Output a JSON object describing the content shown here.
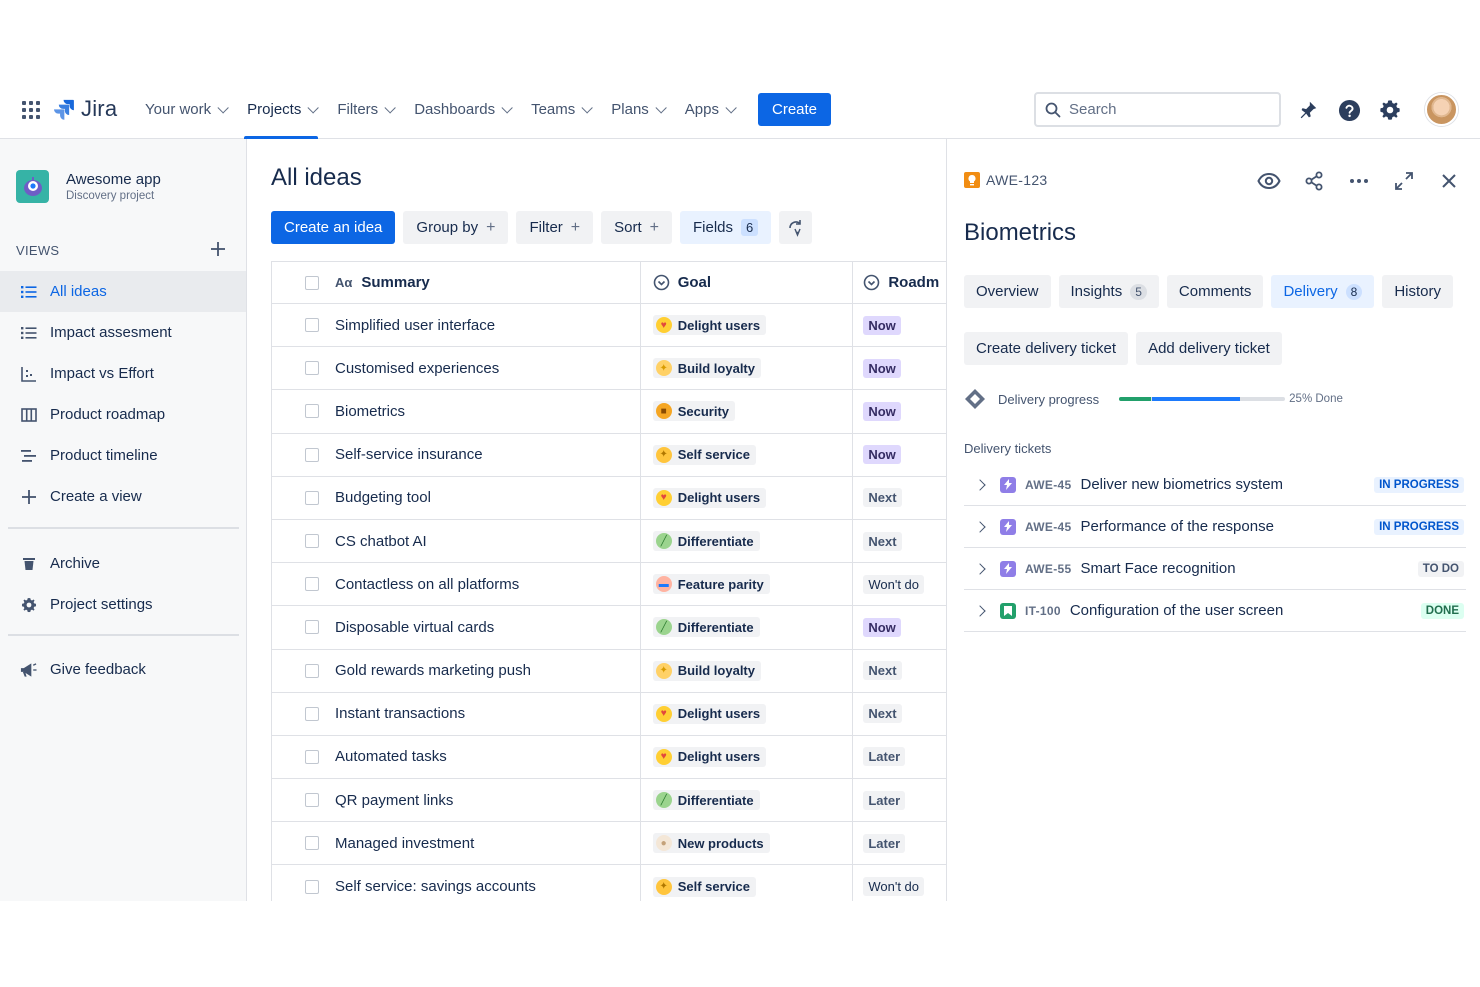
{
  "nav": {
    "logo": "Jira",
    "items": [
      {
        "label": "Your work",
        "active": false
      },
      {
        "label": "Projects",
        "active": true
      },
      {
        "label": "Filters",
        "active": false
      },
      {
        "label": "Dashboards",
        "active": false
      },
      {
        "label": "Teams",
        "active": false
      },
      {
        "label": "Plans",
        "active": false
      },
      {
        "label": "Apps",
        "active": false
      }
    ],
    "create_label": "Create",
    "search_placeholder": "Search"
  },
  "sidebar": {
    "project_name": "Awesome app",
    "project_type": "Discovery project",
    "views_header": "VIEWS",
    "views": [
      {
        "label": "All ideas",
        "icon": "list-icon",
        "active": true
      },
      {
        "label": "Impact assesment",
        "icon": "list-icon",
        "active": false
      },
      {
        "label": "Impact vs Effort",
        "icon": "scatter-icon",
        "active": false
      },
      {
        "label": "Product roadmap",
        "icon": "board-icon",
        "active": false
      },
      {
        "label": "Product timeline",
        "icon": "timeline-icon",
        "active": false
      },
      {
        "label": "Create a view",
        "icon": "plus-icon",
        "active": false
      }
    ],
    "archive_label": "Archive",
    "settings_label": "Project settings",
    "feedback_label": "Give feedback"
  },
  "main": {
    "title": "All ideas",
    "toolbar": {
      "create_idea": "Create an idea",
      "group_by": "Group by",
      "filter": "Filter",
      "sort": "Sort",
      "fields": "Fields",
      "fields_count": "6"
    },
    "columns": {
      "summary_icon": "Aα",
      "summary": "Summary",
      "goal": "Goal",
      "roadmap": "Roadm"
    },
    "rows": [
      {
        "summary": "Simplified user interface",
        "goal": "Delight users",
        "roadmap": "Now"
      },
      {
        "summary": "Customised experiences",
        "goal": "Build loyalty",
        "roadmap": "Now"
      },
      {
        "summary": "Biometrics",
        "goal": "Security",
        "roadmap": "Now"
      },
      {
        "summary": "Self-service insurance",
        "goal": "Self service",
        "roadmap": "Now"
      },
      {
        "summary": "Budgeting tool",
        "goal": "Delight users",
        "roadmap": "Next"
      },
      {
        "summary": "CS chatbot AI",
        "goal": "Differentiate",
        "roadmap": "Next"
      },
      {
        "summary": "Contactless on all platforms",
        "goal": "Feature parity",
        "roadmap": "Won't do"
      },
      {
        "summary": "Disposable virtual cards",
        "goal": "Differentiate",
        "roadmap": "Now"
      },
      {
        "summary": "Gold rewards marketing push",
        "goal": "Build loyalty",
        "roadmap": "Next"
      },
      {
        "summary": "Instant transactions",
        "goal": "Delight users",
        "roadmap": "Next"
      },
      {
        "summary": "Automated tasks",
        "goal": "Delight users",
        "roadmap": "Later"
      },
      {
        "summary": "QR payment links",
        "goal": "Differentiate",
        "roadmap": "Later"
      },
      {
        "summary": "Managed investment",
        "goal": "New products",
        "roadmap": "Later"
      },
      {
        "summary": "Self service: savings accounts",
        "goal": "Self service",
        "roadmap": "Won't do"
      }
    ]
  },
  "panel": {
    "key": "AWE-123",
    "title": "Biometrics",
    "tabs": [
      {
        "label": "Overview",
        "count": null,
        "active": false
      },
      {
        "label": "Insights",
        "count": "5",
        "active": false
      },
      {
        "label": "Comments",
        "count": null,
        "active": false
      },
      {
        "label": "Delivery",
        "count": "8",
        "active": true
      },
      {
        "label": "History",
        "count": null,
        "active": false
      }
    ],
    "create_ticket": "Create delivery ticket",
    "add_ticket": "Add delivery ticket",
    "progress_label": "Delivery progress",
    "progress_done_fraction": 0.19,
    "progress_inprogress_fraction": 0.53,
    "progress_text": "25% Done",
    "tickets_label": "Delivery tickets",
    "tickets": [
      {
        "key": "AWE-45",
        "title": "Deliver new biometrics system",
        "status": "IN PROGRESS",
        "type": "epic"
      },
      {
        "key": "AWE-45",
        "title": "Performance of the response",
        "status": "IN PROGRESS",
        "type": "epic"
      },
      {
        "key": "AWE-55",
        "title": "Smart Face recognition",
        "status": "TO DO",
        "type": "epic"
      },
      {
        "key": "IT-100",
        "title": "Configuration of the user screen",
        "status": "DONE",
        "type": "story"
      }
    ]
  },
  "colors": {
    "brand": "#0c66e4",
    "now_tag": "#dfd8fd",
    "progress_done": "#22a06b",
    "progress_inprogress": "#1d7afc"
  }
}
